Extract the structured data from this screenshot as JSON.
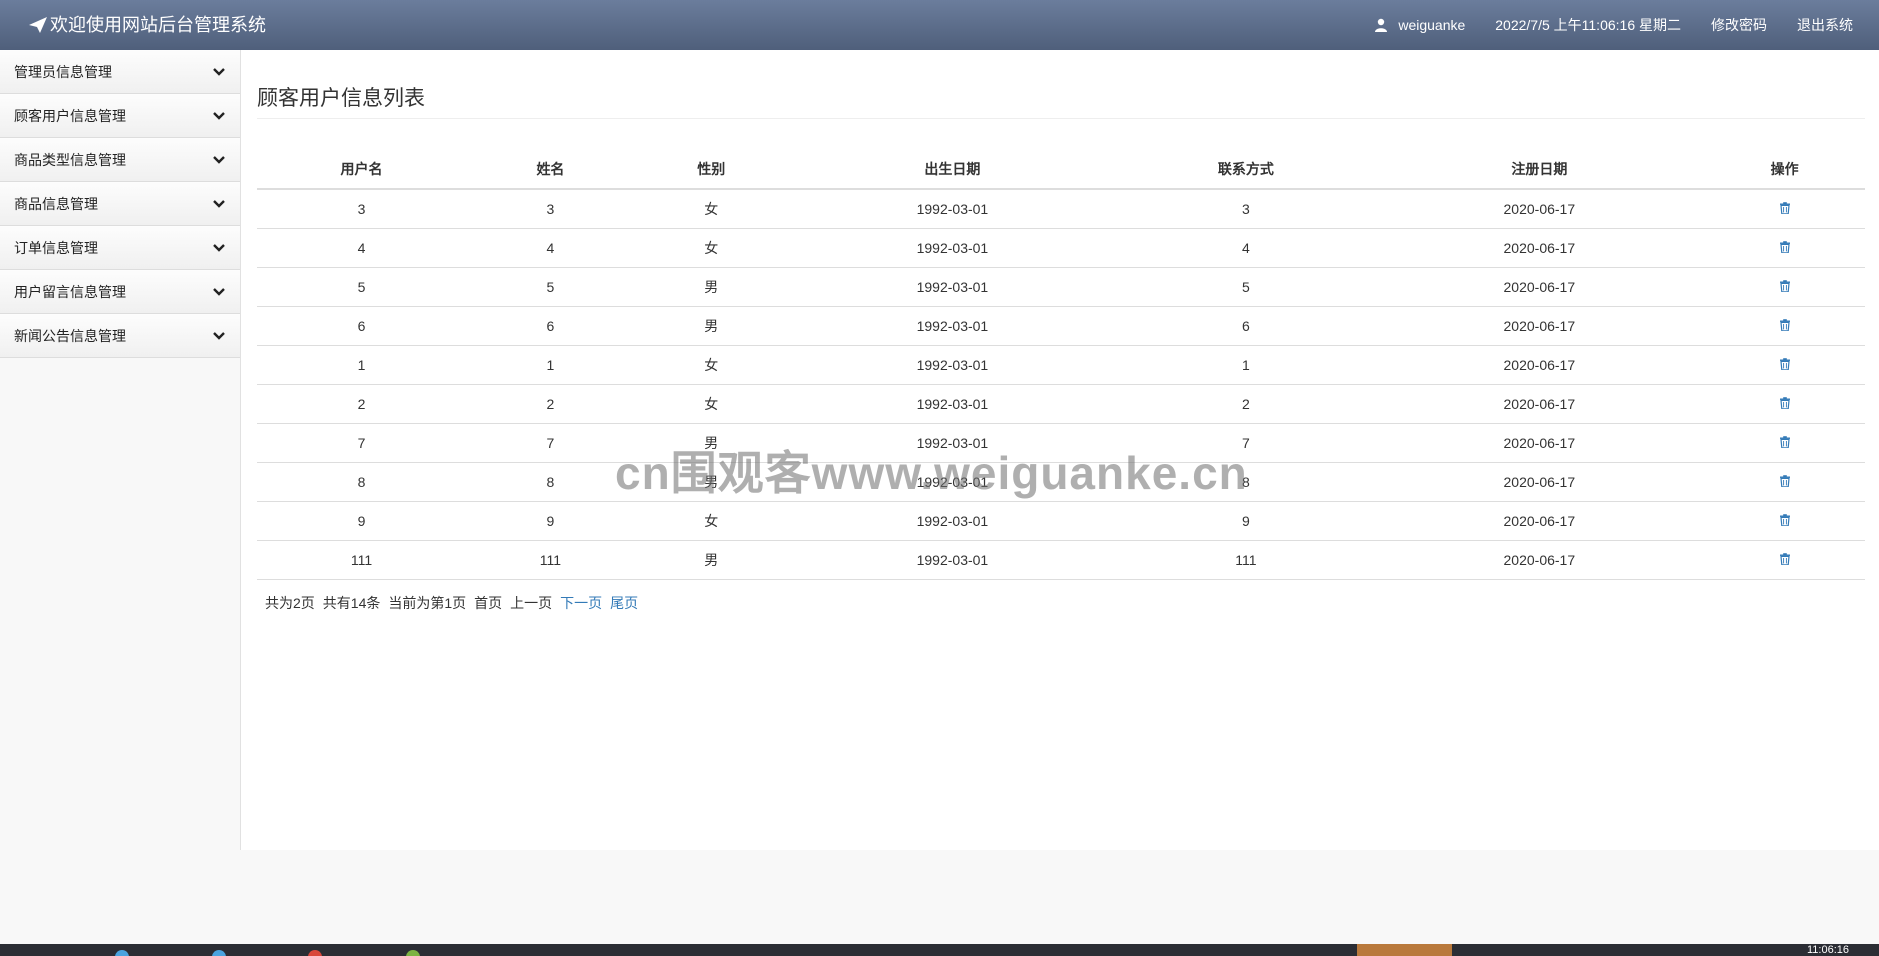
{
  "header": {
    "title": "欢迎使用网站后台管理系统",
    "username": "weiguanke",
    "datetime": "2022/7/5 上午11:06:16 星期二",
    "change_password": "修改密码",
    "logout": "退出系统"
  },
  "sidebar": {
    "items": [
      {
        "label": "管理员信息管理"
      },
      {
        "label": "顾客用户信息管理"
      },
      {
        "label": "商品类型信息管理"
      },
      {
        "label": "商品信息管理"
      },
      {
        "label": "订单信息管理"
      },
      {
        "label": "用户留言信息管理"
      },
      {
        "label": "新闻公告信息管理"
      }
    ]
  },
  "main": {
    "title": "顾客用户信息列表",
    "columns": [
      "用户名",
      "姓名",
      "性别",
      "出生日期",
      "联系方式",
      "注册日期",
      "操作"
    ],
    "rows": [
      [
        "3",
        "3",
        "女",
        "1992-03-01",
        "3",
        "2020-06-17"
      ],
      [
        "4",
        "4",
        "女",
        "1992-03-01",
        "4",
        "2020-06-17"
      ],
      [
        "5",
        "5",
        "男",
        "1992-03-01",
        "5",
        "2020-06-17"
      ],
      [
        "6",
        "6",
        "男",
        "1992-03-01",
        "6",
        "2020-06-17"
      ],
      [
        "1",
        "1",
        "女",
        "1992-03-01",
        "1",
        "2020-06-17"
      ],
      [
        "2",
        "2",
        "女",
        "1992-03-01",
        "2",
        "2020-06-17"
      ],
      [
        "7",
        "7",
        "男",
        "1992-03-01",
        "7",
        "2020-06-17"
      ],
      [
        "8",
        "8",
        "男",
        "1992-03-01",
        "8",
        "2020-06-17"
      ],
      [
        "9",
        "9",
        "女",
        "1992-03-01",
        "9",
        "2020-06-17"
      ],
      [
        "111",
        "111",
        "男",
        "1992-03-01",
        "111",
        "2020-06-17"
      ]
    ]
  },
  "pager": {
    "total_pages": "共为2页",
    "total_records": "共有14条",
    "current_page": "当前为第1页",
    "first": "首页",
    "prev": "上一页",
    "next": "下一页",
    "last": "尾页"
  },
  "watermark": "cn围观客www.weiguanke.cn",
  "taskbar": {
    "time": "11:06:16"
  },
  "colors": {
    "header": "#5a6a88",
    "link": "#337ab7",
    "trash": "#337ab7"
  }
}
